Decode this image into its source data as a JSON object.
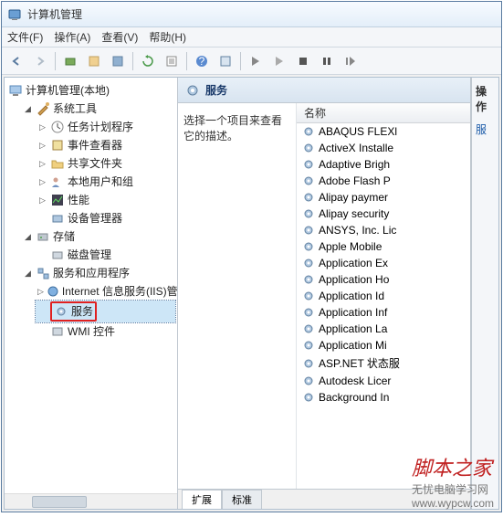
{
  "window": {
    "title": "计算机管理"
  },
  "menu": {
    "file": "文件(F)",
    "action": "操作(A)",
    "view": "查看(V)",
    "help": "帮助(H)"
  },
  "tree": {
    "root": "计算机管理(本地)",
    "system_tools": "系统工具",
    "task_scheduler": "任务计划程序",
    "event_viewer": "事件查看器",
    "shared_folders": "共享文件夹",
    "local_users": "本地用户和组",
    "performance": "性能",
    "device_manager": "设备管理器",
    "storage": "存储",
    "disk_management": "磁盘管理",
    "services_apps": "服务和应用程序",
    "iis": "Internet 信息服务(IIS)管",
    "services": "服务",
    "wmi": "WMI 控件"
  },
  "middle": {
    "title": "服务",
    "desc": "选择一个项目来查看它的描述。",
    "column_name": "名称",
    "items": [
      "ABAQUS FLEXl",
      "ActiveX Installe",
      "Adaptive Brigh",
      "Adobe Flash P",
      "Alipay paymer",
      "Alipay security",
      "ANSYS, Inc. Lic",
      "Apple Mobile",
      "Application Ex",
      "Application Ho",
      "Application Id",
      "Application Inf",
      "Application La",
      "Application Mi",
      "ASP.NET 状态服",
      "Autodesk Licer",
      "Background In"
    ],
    "tab_ext": "扩展",
    "tab_std": "标准"
  },
  "right": {
    "panel": "操作",
    "services": "服"
  },
  "watermark": {
    "red": "脚本之家",
    "url": "无忧电脑学习网",
    "site": "www.wypcw.com"
  }
}
